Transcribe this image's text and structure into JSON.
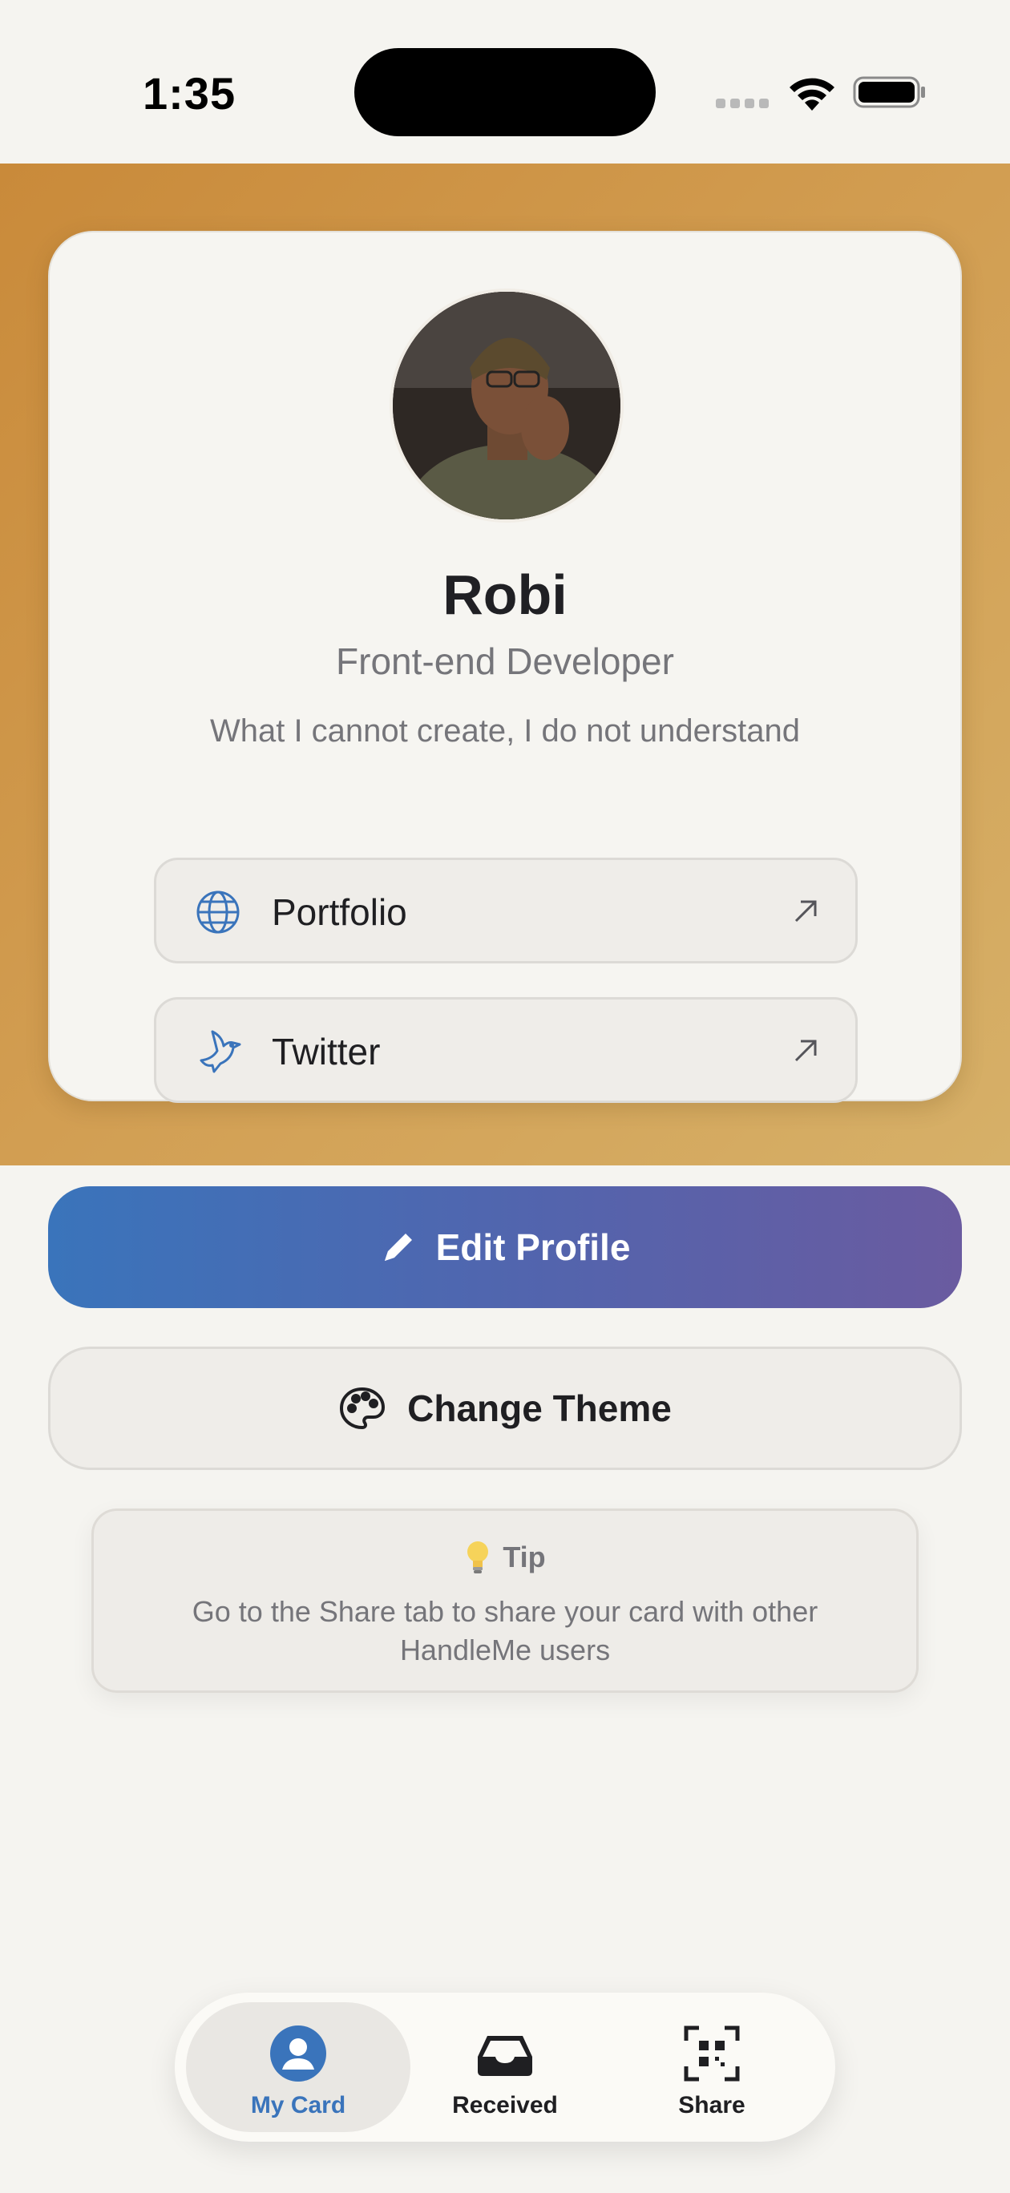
{
  "status_bar": {
    "time": "1:35"
  },
  "profile": {
    "name": "Robi",
    "role": "Front-end Developer",
    "bio": "What I cannot create, I do not understand",
    "links": [
      {
        "label": "Portfolio",
        "icon": "globe-icon"
      },
      {
        "label": "Twitter",
        "icon": "bird-icon"
      }
    ]
  },
  "actions": {
    "edit_label": "Edit Profile",
    "theme_label": "Change Theme"
  },
  "tip": {
    "title": "Tip",
    "text": "Go to the Share tab to share your card with other HandleMe users"
  },
  "tabs": [
    {
      "label": "My Card",
      "icon": "person-icon",
      "active": true
    },
    {
      "label": "Received",
      "icon": "inbox-icon",
      "active": false
    },
    {
      "label": "Share",
      "icon": "qr-code-icon",
      "active": false
    }
  ],
  "colors": {
    "accent": "#3a74bb",
    "hero_start": "#c98a3a",
    "hero_end": "#d6b068",
    "button_gradient_end": "#6a5ba0"
  }
}
